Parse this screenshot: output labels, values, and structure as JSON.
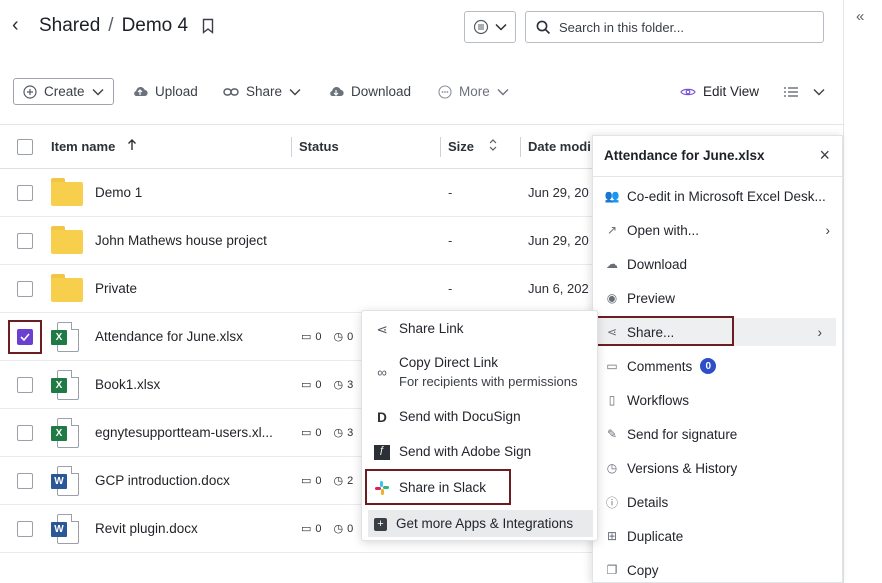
{
  "breadcrumb": {
    "parent": "Shared",
    "separator": "/",
    "current": "Demo 4"
  },
  "search": {
    "placeholder": "Search in this folder..."
  },
  "toolbar": {
    "create": "Create",
    "upload": "Upload",
    "share": "Share",
    "download": "Download",
    "more": "More",
    "edit_view": "Edit View"
  },
  "table": {
    "headers": {
      "name": "Item name",
      "status": "Status",
      "size": "Size",
      "date": "Date modi"
    },
    "rows": [
      {
        "name": "Demo 1",
        "type": "folder",
        "size": "-",
        "date": "Jun 29, 20",
        "selected": false
      },
      {
        "name": "John Mathews house project",
        "type": "folder",
        "size": "-",
        "date": "Jun 29, 20",
        "selected": false
      },
      {
        "name": "Private",
        "type": "folder",
        "size": "-",
        "date": "Jun 6, 202",
        "selected": false
      },
      {
        "name": "Attendance for June.xlsx",
        "type": "xlsx",
        "comments": "0",
        "versions": "0",
        "selected": true
      },
      {
        "name": "Book1.xlsx",
        "type": "xlsx",
        "comments": "0",
        "versions": "3",
        "selected": false
      },
      {
        "name": "egnytesupportteam-users.xl...",
        "type": "xlsx",
        "comments": "0",
        "versions": "3",
        "selected": false
      },
      {
        "name": "GCP introduction.docx",
        "type": "docx",
        "comments": "0",
        "versions": "2",
        "selected": false
      },
      {
        "name": "Revit plugin.docx",
        "type": "docx",
        "comments": "0",
        "versions": "0",
        "selected": false
      }
    ]
  },
  "details_panel": {
    "title": "Attendance for June.xlsx",
    "items": [
      {
        "label": "Co-edit in Microsoft Excel Desk...",
        "icon": "co-edit-icon"
      },
      {
        "label": "Open with...",
        "icon": "open-external-icon",
        "has_submenu": true
      },
      {
        "label": "Download",
        "icon": "cloud-download-icon"
      },
      {
        "label": "Preview",
        "icon": "eye-icon"
      },
      {
        "label": "Share...",
        "icon": "share-icon",
        "has_submenu": true,
        "active": true
      },
      {
        "label": "Comments",
        "icon": "comment-icon",
        "badge": "0"
      },
      {
        "label": "Workflows",
        "icon": "clipboard-icon"
      },
      {
        "label": "Send for signature",
        "icon": "signature-icon"
      },
      {
        "label": "Versions & History",
        "icon": "history-icon"
      },
      {
        "label": "Details",
        "icon": "info-icon"
      },
      {
        "label": "Duplicate",
        "icon": "duplicate-icon"
      },
      {
        "label": "Copy",
        "icon": "copy-icon"
      }
    ]
  },
  "share_submenu": {
    "share_link": "Share Link",
    "copy_direct_link": "Copy Direct Link",
    "copy_direct_link_sub": "For recipients with permissions",
    "docusign": "Send with DocuSign",
    "adobe_sign": "Send with Adobe Sign",
    "slack": "Share in Slack",
    "more_apps": "Get more Apps & Integrations"
  },
  "colors": {
    "accent": "#6b3fd1",
    "highlight_border": "#6b1d22",
    "badge": "#2e4fc8",
    "excel": "#1f7a45",
    "word": "#2b5797",
    "folder": "#f8cf4d"
  }
}
